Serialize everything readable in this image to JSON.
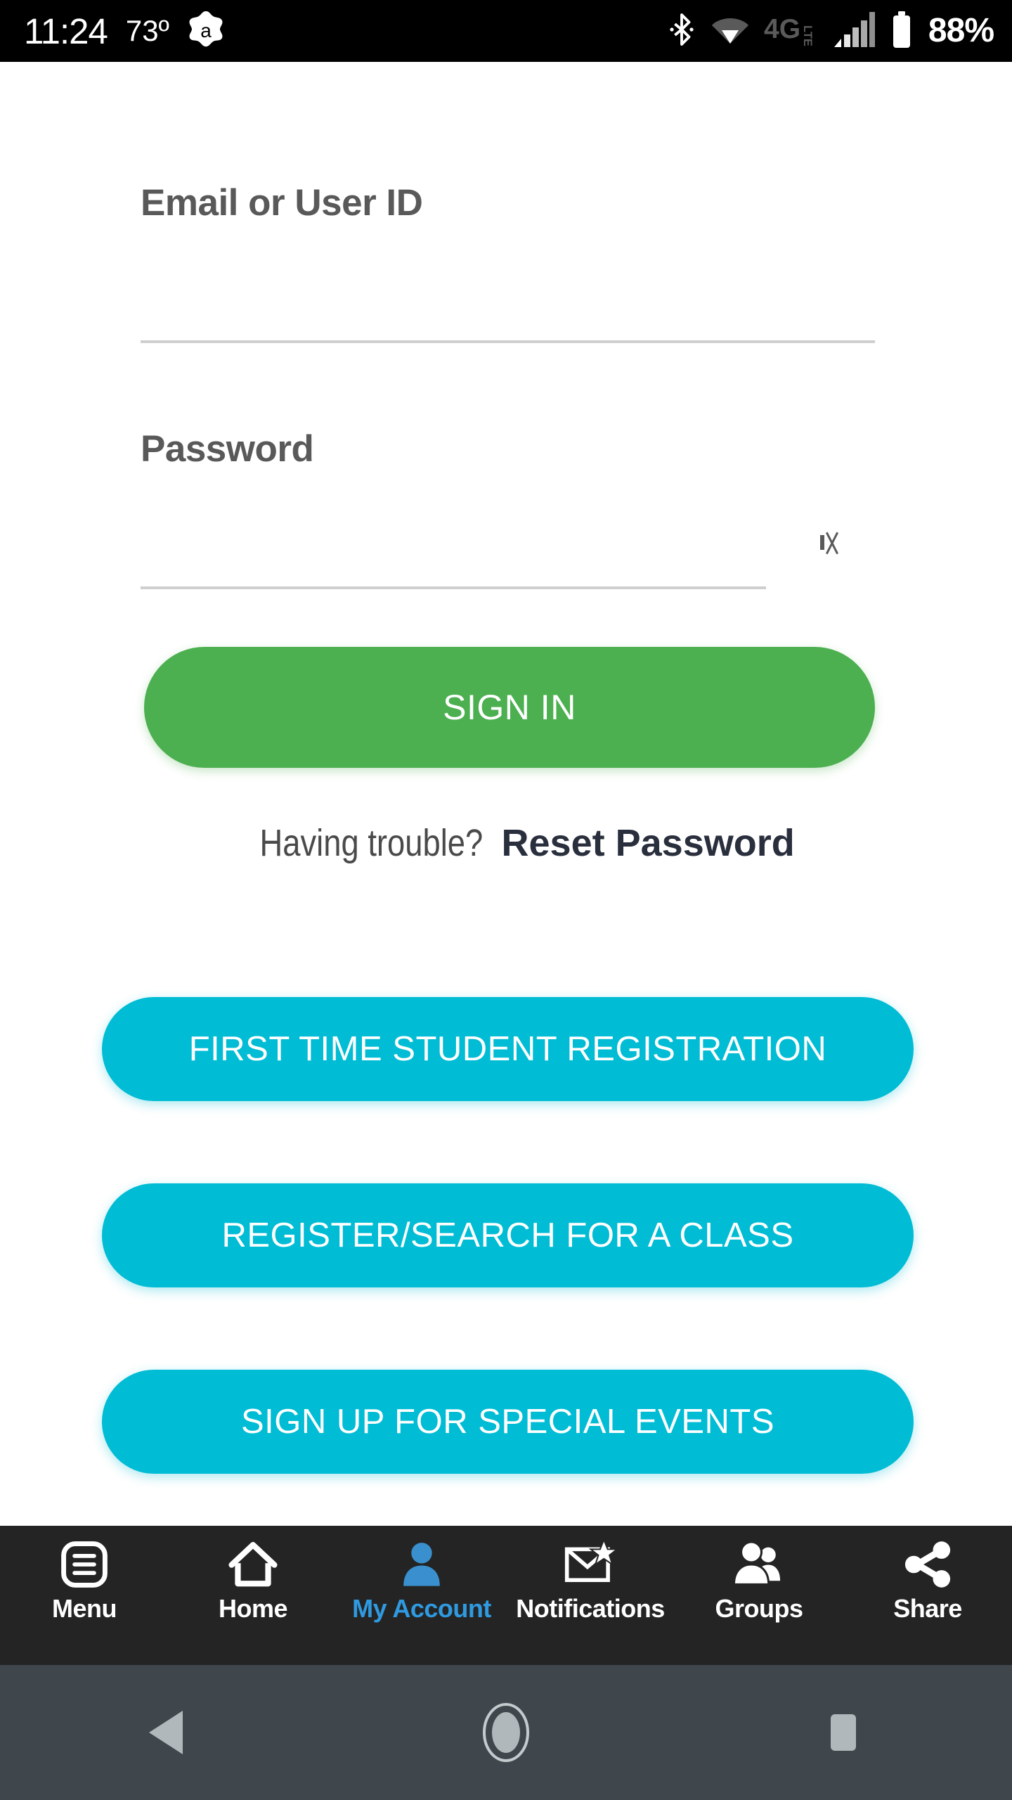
{
  "status_bar": {
    "time": "11:24",
    "temperature": "73º",
    "app_icon": "avast-icon",
    "bluetooth_icon": "bluetooth-icon",
    "wifi_icon": "wifi-icon",
    "network_type": "4G LTE",
    "signal_icon": "cellular-signal-icon",
    "battery_icon": "battery-icon",
    "battery_percent": "88%"
  },
  "form": {
    "email_label": "Email or User ID",
    "email_value": "",
    "email_placeholder": "",
    "password_label": "Password",
    "password_value": "",
    "password_placeholder": "",
    "password_toggle_icon": "show-password-icon",
    "signin_label": "SIGN IN"
  },
  "help": {
    "prompt": "Having trouble?",
    "reset_link": "Reset Password"
  },
  "actions": [
    {
      "label": "FIRST TIME STUDENT REGISTRATION"
    },
    {
      "label": "REGISTER/SEARCH FOR A CLASS"
    },
    {
      "label": "SIGN UP FOR SPECIAL EVENTS"
    }
  ],
  "bottom_nav": {
    "items": [
      {
        "label": "Menu",
        "icon": "menu-icon",
        "active": false
      },
      {
        "label": "Home",
        "icon": "home-icon",
        "active": false
      },
      {
        "label": "My Account",
        "icon": "person-icon",
        "active": true
      },
      {
        "label": "Notifications",
        "icon": "envelope-star-icon",
        "active": false
      },
      {
        "label": "Groups",
        "icon": "people-icon",
        "active": false
      },
      {
        "label": "Share",
        "icon": "share-icon",
        "active": false
      }
    ]
  },
  "system_nav": {
    "back_icon": "back-triangle-icon",
    "home_icon": "home-circle-icon",
    "recents_icon": "recents-square-icon"
  },
  "colors": {
    "primary_green": "#4caf50",
    "accent_cyan": "#00bcd4",
    "active_nav_blue": "#2f9ae0",
    "nav_background": "#242424",
    "system_nav_background": "#3f474d",
    "label_gray": "#595959",
    "reset_link_navy": "#2a2f3d"
  }
}
